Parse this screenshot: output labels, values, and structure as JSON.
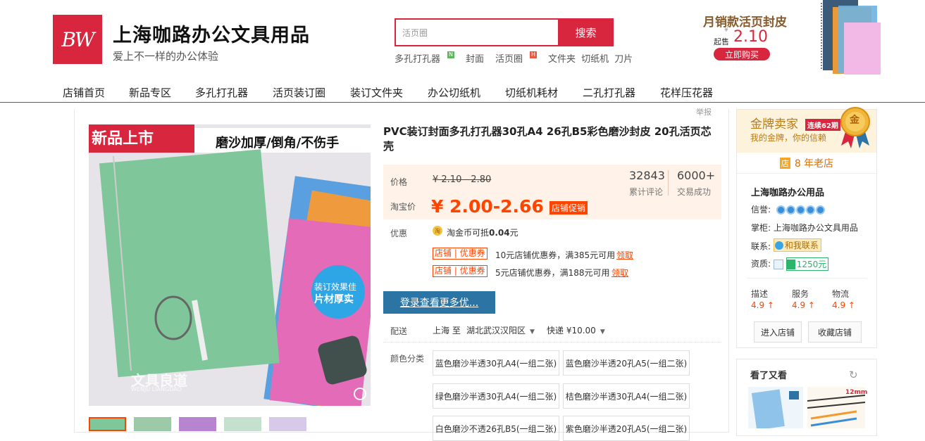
{
  "header": {
    "logo_text": "BW",
    "shop_name": "上海咖路办公文具用品",
    "slogan": "爱上不一样的办公体验",
    "search_placeholder": "活页圈",
    "search_button": "搜索",
    "hot_words": [
      "多孔打孔器",
      "封面",
      "活页圈",
      "文件夹",
      "切纸机",
      "刀片"
    ],
    "hot_tags": {
      "n": "N",
      "h": "H"
    },
    "promo": {
      "title_bold": "月销款",
      "title_rest": "活页封皮",
      "from_label": "起售",
      "currency": "¥",
      "price": "2.10",
      "button": "立即购买"
    }
  },
  "nav": {
    "items": [
      "店铺首页",
      "新品专区",
      "多孔打孔器",
      "活页装订圈",
      "装订文件夹",
      "办公切纸机",
      "切纸机耗材",
      "二孔打孔器",
      "花样压花器"
    ]
  },
  "product": {
    "report": "举报",
    "title": "PVC装订封面多孔打孔器30孔A4 26孔B5彩色磨沙封皮 20孔活页芯壳",
    "image": {
      "banner_left": "新品上市",
      "banner_right": "磨沙加厚/倒角/不伤手",
      "circle_line1": "装订效果佳",
      "circle_line2": "片材厚实",
      "watermark": "文具良道",
      "watermark_en": "WENJU LIANGDAO"
    },
    "price_label": "价格",
    "original_price": "¥ 2.10 - 2.80",
    "taobao_label": "淘宝价",
    "sale_price": "¥ 2.00-2.66",
    "sale_tag": "店铺促销",
    "stats": [
      {
        "num": "32843",
        "label": "累计评论"
      },
      {
        "num": "6000+",
        "label": "交易成功"
      }
    ],
    "discount_label": "优惠",
    "coin_icon": "淘",
    "coin_text": "淘金币可抵",
    "coin_value": "0.04",
    "coin_unit": "元",
    "coupons": [
      {
        "tag": "店铺 | 优惠券",
        "text": "10元店铺优惠券，满385元可用",
        "action": "领取"
      },
      {
        "tag": "店铺 | 优惠券",
        "text": "5元店铺优惠券，满188元可用",
        "action": "领取"
      }
    ],
    "login_button": "登录查看更多优...",
    "shipping_label": "配送",
    "ship_from": "上海 至",
    "ship_to": "湖北武汉汉阳区",
    "ship_method": "快递 ¥10.00",
    "color_label": "颜色分类",
    "skus": [
      "蓝色磨沙半透30孔A4(一组二张)",
      "蓝色磨沙半透20孔A5(一组二张)",
      "绿色磨沙半透30孔A4(一组二张)",
      "桔色磨沙半透30孔A4(一组二张)",
      "白色磨沙不透26孔B5(一组二张)",
      "紫色磨沙半透20孔A5(一组二张)"
    ]
  },
  "sidebar": {
    "gold_title": "金牌卖家",
    "gold_tag": "连续62期",
    "gold_sub": "我的金牌，你的信赖",
    "medal_text": "金",
    "years_icon": "店",
    "years": "8 年老店",
    "seller_name": "上海咖路办公用品",
    "credit_label": "信誉:",
    "keeper_label": "掌柜:",
    "keeper_name": "上海咖路办公文具用品",
    "contact_label": "联系:",
    "contact_button": "和我联系",
    "qual_label": "资质:",
    "qual_value": "1250元",
    "scores": [
      {
        "label": "描述",
        "value": "4.9 ↑"
      },
      {
        "label": "服务",
        "value": "4.9 ↑"
      },
      {
        "label": "物流",
        "value": "4.9 ↑"
      }
    ],
    "enter_shop": "进入店铺",
    "fav_shop": "收藏店铺",
    "also_viewed": "看了又看",
    "also_img_label": "12mm"
  },
  "colors": {
    "brand_red": "#d9263f",
    "price_orange": "#ff4400",
    "login_blue": "#2b74a3",
    "gold": "#b97a16"
  }
}
